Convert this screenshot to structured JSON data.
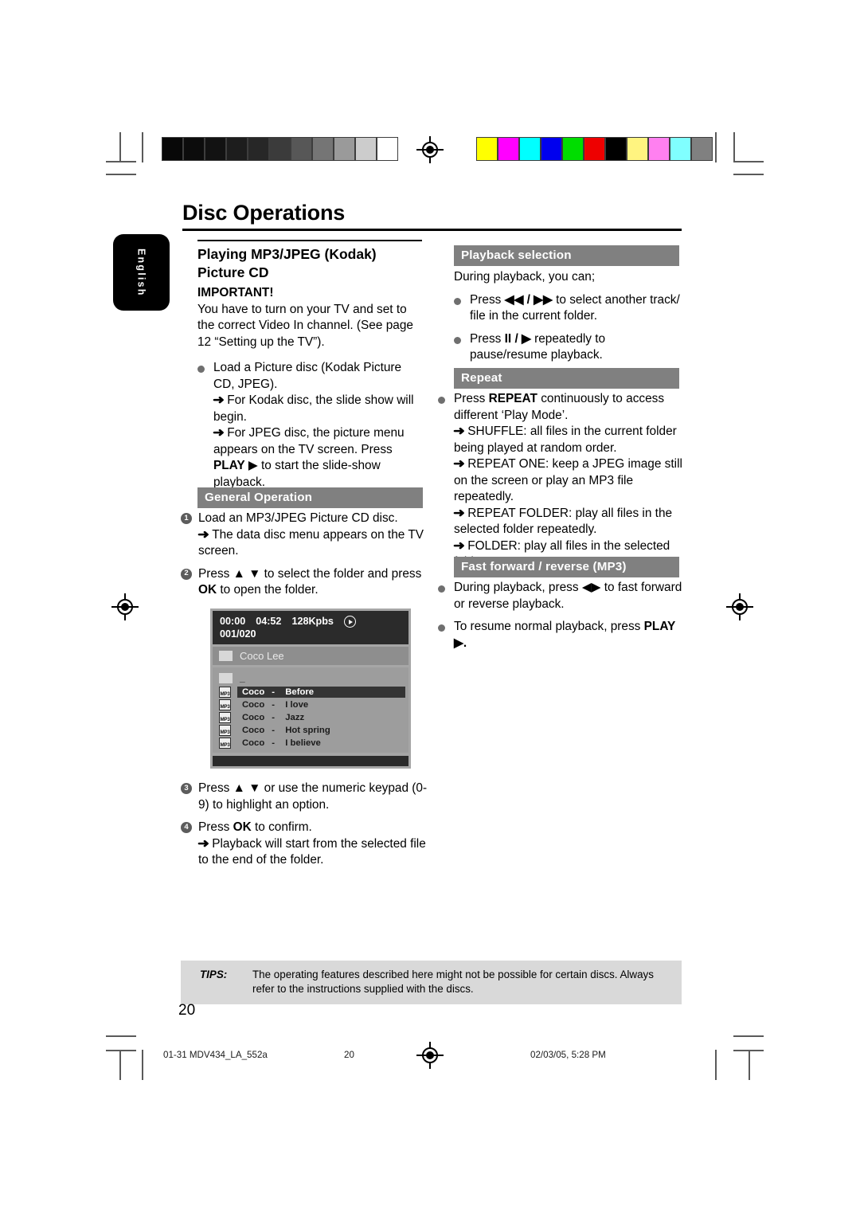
{
  "doc": {
    "title": "Disc Operations",
    "language_tab": "English",
    "page_number": "20"
  },
  "calibration": {
    "gray_swatches": [
      "#080808",
      "#0c0c0c",
      "#121212",
      "#1d1d1d",
      "#272727",
      "#3b3b3b",
      "#575757",
      "#757575",
      "#9a9a9a",
      "#cccccc",
      "#ffffff"
    ],
    "color_swatches": [
      "#ffff00",
      "#ff00ff",
      "#00ffff",
      "#0000ee",
      "#00dd00",
      "#ee0000",
      "#000000",
      "#fff480",
      "#ff80f0",
      "#80ffff",
      "#808080"
    ]
  },
  "left": {
    "heading_line1": "Playing MP3/JPEG (Kodak)",
    "heading_line2": "Picture CD",
    "important_label": "IMPORTANT!",
    "important_text": "You have to turn on your TV and set to the correct Video In channel.  (See page 12 “Setting up the TV”).",
    "bullet1_line1": "Load a Picture disc (Kodak Picture CD, JPEG).",
    "bullet1_arrow1": "For Kodak disc, the slide show will begin.",
    "bullet1_arrow2_a": "For JPEG disc, the picture menu appears on the TV screen. Press ",
    "bullet1_arrow2_b": "PLAY",
    "bullet1_arrow2_c": " ▶ to start the slide-show playback.",
    "section_general": "General Operation",
    "step1_text": "Load an MP3/JPEG Picture CD disc.",
    "step1_arrow": "The data disc menu appears on the TV screen.",
    "step2_a": "Press ▲ ▼  to select the folder and press ",
    "step2_b": "OK",
    "step2_c": " to open the folder.",
    "step3_a": "Press ▲ ▼ or use the numeric keypad (0-9) to highlight an option.",
    "step4_a": "Press ",
    "step4_b": "OK",
    "step4_c": " to confirm.",
    "step4_arrow": "Playback will start from the selected file to the end of the folder.",
    "step_numbers": [
      "1",
      "2",
      "3",
      "4"
    ]
  },
  "screenshot": {
    "elapsed_time": "00:00",
    "total_time": "04:52",
    "bitrate": "128Kpbs",
    "play_icon": "play-circle-icon",
    "track_counter": "001/020",
    "folder_name": "Coco Lee",
    "parent_entry": "_",
    "file_type_label": "MP3",
    "tracks": [
      {
        "artist": "Coco",
        "sep": "-",
        "title": "Before",
        "selected": true
      },
      {
        "artist": "Coco",
        "sep": "-",
        "title": "I love",
        "selected": false
      },
      {
        "artist": "Coco",
        "sep": "-",
        "title": "Jazz",
        "selected": false
      },
      {
        "artist": "Coco",
        "sep": "-",
        "title": "Hot spring",
        "selected": false
      },
      {
        "artist": "Coco",
        "sep": "-",
        "title": "I believe",
        "selected": false
      }
    ]
  },
  "right": {
    "section_playback": "Playback selection",
    "playback_intro": "During playback, you can;",
    "pb_b1_a": "Press ",
    "pb_b1_b": "◀◀ / ▶▶",
    "pb_b1_c": " to select another track/ file in the current folder.",
    "pb_b2_a": "Press ",
    "pb_b2_b": "II / ▶",
    "pb_b2_c": " repeatedly to pause/resume playback.",
    "section_repeat": "Repeat",
    "rp_b1_a": "Press ",
    "rp_b1_b": "REPEAT",
    "rp_b1_c": " continuously to access different ‘Play Mode’.",
    "rp_arrow1": "SHUFFLE: all files in the current folder being played at random order.",
    "rp_arrow2": "REPEAT ONE: keep a JPEG image still on the screen or play an MP3 file repeatedly.",
    "rp_arrow3": "REPEAT FOLDER: play all files in the selected folder repeatedly.",
    "rp_arrow4": "FOLDER: play all files in the selected folder.",
    "section_ff": "Fast forward / reverse (MP3)",
    "ff_b1": "During playback, press ◀▶ to fast forward or reverse playback.",
    "ff_b2_a": "To resume normal playback, press ",
    "ff_b2_b": "PLAY",
    "ff_b2_c": " ▶."
  },
  "tips": {
    "label": "TIPS:",
    "text": "The operating features described here might not be possible for certain discs.  Always refer to the instructions supplied with the discs."
  },
  "footer": {
    "file_name": "01-31 MDV434_LA_552a",
    "page": "20",
    "timestamp": "02/03/05, 5:28 PM"
  }
}
